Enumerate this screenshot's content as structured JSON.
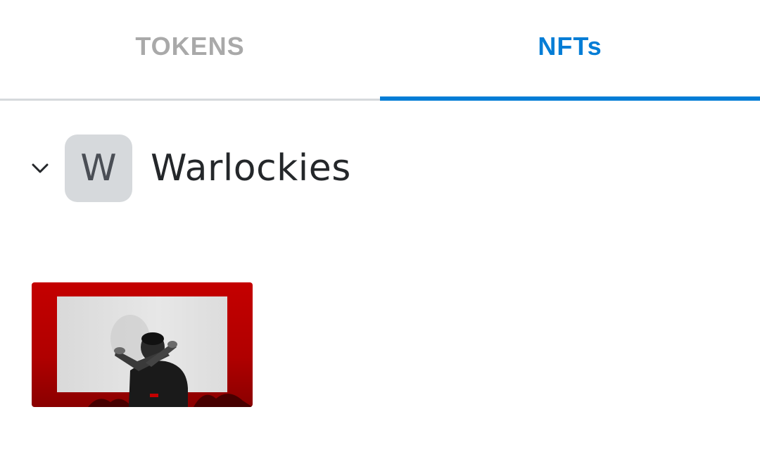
{
  "tabs": [
    {
      "label": "TOKENS",
      "active": false
    },
    {
      "label": "NFTs",
      "active": true
    }
  ],
  "collection": {
    "avatar_letter": "W",
    "name": "Warlockies",
    "expand_icon": "chevron-down-icon"
  },
  "nfts": [
    {
      "image": "nft-thumbnail"
    }
  ],
  "colors": {
    "accent": "#037dd6",
    "inactive_tab": "#a9a9a9",
    "avatar_bg": "#d6d9dc",
    "text": "#24272a"
  }
}
